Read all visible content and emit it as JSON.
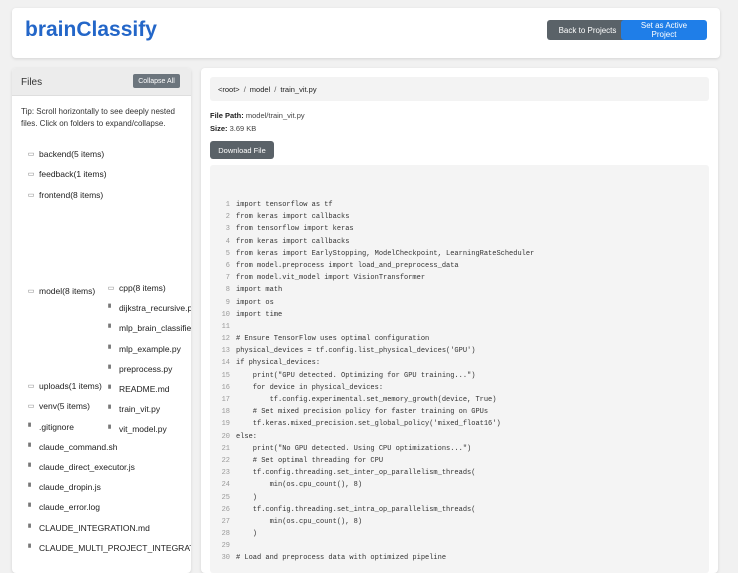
{
  "app": {
    "logo": "brainClassify",
    "back_label": "Back to Projects",
    "active_label": "Set as Active Project"
  },
  "sidebar": {
    "title": "Files",
    "collapse_label": "Collapse All",
    "tip": "Tip: Scroll horizontally to see deeply nested files. Click on folders to expand/collapse.",
    "items": [
      {
        "label": "backend(5 items)",
        "type": "folder"
      },
      {
        "label": "feedback(1 items)",
        "type": "folder"
      },
      {
        "label": "frontend(8 items)",
        "type": "folder"
      },
      {
        "label": "model(8 items)",
        "type": "folder"
      },
      {
        "label": "uploads(1 items)",
        "type": "folder"
      },
      {
        "label": "venv(5 items)",
        "type": "folder"
      },
      {
        "label": ".gitignore",
        "type": "file"
      },
      {
        "label": "claude_command.sh",
        "type": "file"
      },
      {
        "label": "claude_direct_executor.js",
        "type": "file"
      },
      {
        "label": "claude_dropin.js",
        "type": "file"
      },
      {
        "label": "claude_error.log",
        "type": "file"
      },
      {
        "label": "CLAUDE_INTEGRATION.md",
        "type": "file"
      },
      {
        "label": "CLAUDE_MULTI_PROJECT_INTEGRATION",
        "type": "file"
      }
    ],
    "model_children": [
      {
        "label": "cpp(8 items)",
        "type": "folder"
      },
      {
        "label": "dijkstra_recursive.py",
        "type": "file"
      },
      {
        "label": "mlp_brain_classifier.py",
        "type": "file"
      },
      {
        "label": "mlp_example.py",
        "type": "file"
      },
      {
        "label": "preprocess.py",
        "type": "file"
      },
      {
        "label": "README.md",
        "type": "file"
      },
      {
        "label": "train_vit.py",
        "type": "file"
      },
      {
        "label": "vit_model.py",
        "type": "file"
      }
    ]
  },
  "main": {
    "breadcrumb": [
      "<root>",
      "model",
      "train_vit.py"
    ],
    "file_path_label": "File Path:",
    "file_path": "model/train_vit.py",
    "size_label": "Size:",
    "size": "3.69 KB",
    "download_label": "Download File",
    "code": [
      "import tensorflow as tf",
      "from keras import callbacks",
      "from tensorflow import keras",
      "from keras import callbacks",
      "from keras import EarlyStopping, ModelCheckpoint, LearningRateScheduler",
      "from model.preprocess import load_and_preprocess_data",
      "from model.vit_model import VisionTransformer",
      "import math",
      "import os",
      "import time",
      "",
      "# Ensure TensorFlow uses optimal configuration",
      "physical_devices = tf.config.list_physical_devices('GPU')",
      "if physical_devices:",
      "    print(\"GPU detected. Optimizing for GPU training...\")",
      "    for device in physical_devices:",
      "        tf.config.experimental.set_memory_growth(device, True)",
      "    # Set mixed precision policy for faster training on GPUs",
      "    tf.keras.mixed_precision.set_global_policy('mixed_float16')",
      "else:",
      "    print(\"No GPU detected. Using CPU optimizations...\")",
      "    # Set optimal threading for CPU",
      "    tf.config.threading.set_inter_op_parallelism_threads(",
      "        min(os.cpu_count(), 8)",
      "    )",
      "    tf.config.threading.set_intra_op_parallelism_threads(",
      "        min(os.cpu_count(), 8)",
      "    )",
      "",
      "# Load and preprocess data with optimized pipeline"
    ]
  },
  "colors": {
    "brand": "#2366c8",
    "primary_button": "#1f7ee8",
    "secondary_button": "#5a6268"
  },
  "icons": {
    "folder": "folder-icon",
    "file": "file-icon"
  }
}
